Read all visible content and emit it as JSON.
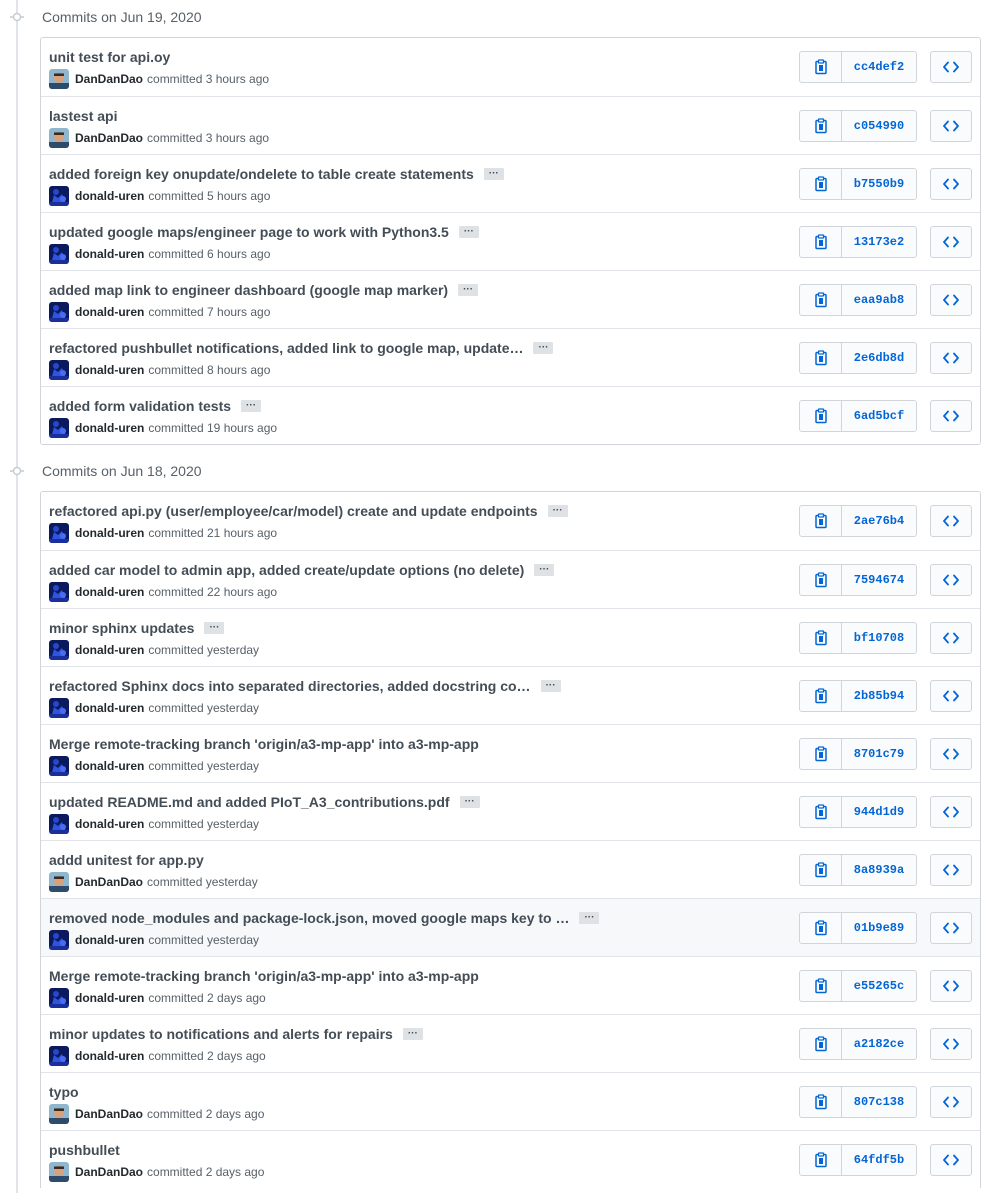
{
  "colors": {
    "link": "#0366d6",
    "border": "#d1d5da",
    "muted": "#586069",
    "highlight_row": "#f6f8fa"
  },
  "icons": {
    "copy": "clipboard-icon",
    "browse": "code-icon",
    "expand": "ellipsis-icon",
    "timeline": "commit-node-icon"
  },
  "groups": [
    {
      "title": "Commits on Jun 19, 2020",
      "commits": [
        {
          "message": "unit test for api.oy",
          "has_more": false,
          "author": "DanDanDao",
          "avatar": "dandandao",
          "time": "committed 3 hours ago",
          "sha": "cc4def2"
        },
        {
          "message": "lastest api",
          "has_more": false,
          "author": "DanDanDao",
          "avatar": "dandandao",
          "time": "committed 3 hours ago",
          "sha": "c054990"
        },
        {
          "message": "added foreign key onupdate/ondelete to table create statements",
          "has_more": true,
          "author": "donald-uren",
          "avatar": "donald",
          "time": "committed 5 hours ago",
          "sha": "b7550b9"
        },
        {
          "message": "updated google maps/engineer page to work with Python3.5",
          "has_more": true,
          "author": "donald-uren",
          "avatar": "donald",
          "time": "committed 6 hours ago",
          "sha": "13173e2"
        },
        {
          "message": "added map link to engineer dashboard (google map marker)",
          "has_more": true,
          "author": "donald-uren",
          "avatar": "donald",
          "time": "committed 7 hours ago",
          "sha": "eaa9ab8"
        },
        {
          "message": "refactored pushbullet notifications, added link to google map, update…",
          "has_more": true,
          "author": "donald-uren",
          "avatar": "donald",
          "time": "committed 8 hours ago",
          "sha": "2e6db8d"
        },
        {
          "message": "added form validation tests",
          "has_more": true,
          "author": "donald-uren",
          "avatar": "donald",
          "time": "committed 19 hours ago",
          "sha": "6ad5bcf"
        }
      ]
    },
    {
      "title": "Commits on Jun 18, 2020",
      "commits": [
        {
          "message": "refactored api.py (user/employee/car/model) create and update endpoints",
          "has_more": true,
          "author": "donald-uren",
          "avatar": "donald",
          "time": "committed 21 hours ago",
          "sha": "2ae76b4"
        },
        {
          "message": "added car model to admin app, added create/update options (no delete)",
          "has_more": true,
          "author": "donald-uren",
          "avatar": "donald",
          "time": "committed 22 hours ago",
          "sha": "7594674"
        },
        {
          "message": "minor sphinx updates",
          "has_more": true,
          "author": "donald-uren",
          "avatar": "donald",
          "time": "committed yesterday",
          "sha": "bf10708"
        },
        {
          "message": "refactored Sphinx docs into separated directories, added docstring co…",
          "has_more": true,
          "author": "donald-uren",
          "avatar": "donald",
          "time": "committed yesterday",
          "sha": "2b85b94"
        },
        {
          "message": "Merge remote-tracking branch 'origin/a3-mp-app' into a3-mp-app",
          "has_more": false,
          "author": "donald-uren",
          "avatar": "donald",
          "time": "committed yesterday",
          "sha": "8701c79"
        },
        {
          "message": "updated README.md and added PIoT_A3_contributions.pdf",
          "has_more": true,
          "author": "donald-uren",
          "avatar": "donald",
          "time": "committed yesterday",
          "sha": "944d1d9"
        },
        {
          "message": "addd unitest for app.py",
          "has_more": false,
          "author": "DanDanDao",
          "avatar": "dandandao",
          "time": "committed yesterday",
          "sha": "8a8939a"
        },
        {
          "message": "removed node_modules and package-lock.json, moved google maps key to …",
          "has_more": true,
          "author": "donald-uren",
          "avatar": "donald",
          "time": "committed yesterday",
          "sha": "01b9e89",
          "highlighted": true
        },
        {
          "message": "Merge remote-tracking branch 'origin/a3-mp-app' into a3-mp-app",
          "has_more": false,
          "author": "donald-uren",
          "avatar": "donald",
          "time": "committed 2 days ago",
          "sha": "e55265c"
        },
        {
          "message": "minor updates to notifications and alerts for repairs",
          "has_more": true,
          "author": "donald-uren",
          "avatar": "donald",
          "time": "committed 2 days ago",
          "sha": "a2182ce"
        },
        {
          "message": "typo",
          "has_more": false,
          "author": "DanDanDao",
          "avatar": "dandandao",
          "time": "committed 2 days ago",
          "sha": "807c138"
        },
        {
          "message": "pushbullet",
          "has_more": false,
          "author": "DanDanDao",
          "avatar": "dandandao",
          "time": "committed 2 days ago",
          "sha": "64fdf5b"
        }
      ]
    }
  ]
}
